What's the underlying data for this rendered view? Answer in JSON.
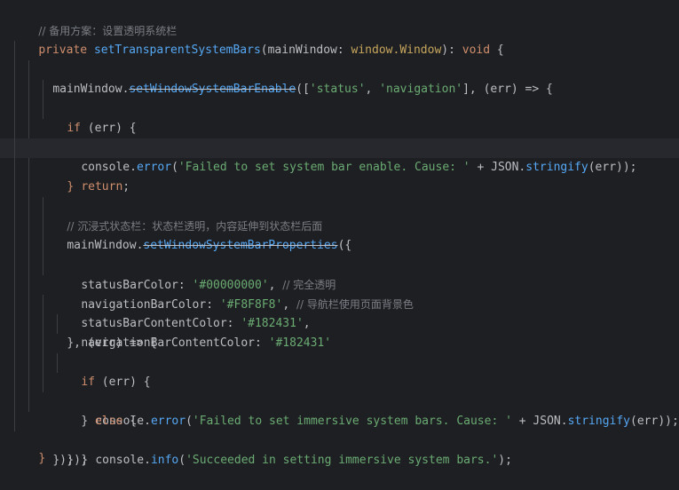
{
  "code": {
    "l1_comment": "// 备用方案：设置透明系统栏",
    "l2_private": "private ",
    "l2_fn": "setTransparentSystemBars",
    "l2_args_open": "(mainWindow: ",
    "l2_type": "window.Window",
    "l2_args_close": "): ",
    "l2_void": "void",
    "l2_brace": " {",
    "l3_obj": "mainWindow.",
    "l3_method": "setWindowSystemBarEnable",
    "l3_open": "([",
    "l3_str1": "'status'",
    "l3_comma": ", ",
    "l3_str2": "'navigation'",
    "l3_rest": "], (err) => {",
    "l4_if": "if",
    "l4_rest": " (err) {",
    "l5_obj": "console.",
    "l5_method": "error",
    "l5_open": "(",
    "l5_str": "'Failed to set system bar enable. Cause: '",
    "l5_plus": " + JSON.",
    "l5_fn": "stringify",
    "l5_rest": "(err));",
    "l6_return": "return",
    "l6_semi": ";",
    "l7_brace": "}",
    "l9_comment": "// 沉浸式状态栏：状态栏透明，内容延伸到状态栏后面",
    "l10_obj": "mainWindow.",
    "l10_method": "setWindowSystemBarProperties",
    "l10_open": "({",
    "l11_key": "statusBarColor: ",
    "l11_val": "'#00000000'",
    "l11_comma": ", ",
    "l11_comment": "// 完全透明",
    "l12_key": "navigationBarColor: ",
    "l12_val": "'#F8F8F8'",
    "l12_comma": ", ",
    "l12_comment": "// 导航栏使用页面背景色",
    "l13_key": "statusBarContentColor: ",
    "l13_val": "'#182431'",
    "l13_comma": ",",
    "l14_key": "navigationBarContentColor: ",
    "l14_val": "'#182431'",
    "l15_text": "}, (err) => {",
    "l16_if": "if",
    "l16_rest": " (err) {",
    "l17_obj": "console.",
    "l17_method": "error",
    "l17_open": "(",
    "l17_str": "'Failed to set immersive system bars. Cause: '",
    "l17_plus": " + JSON.",
    "l17_fn": "stringify",
    "l17_rest": "(err));",
    "l18_close": "} ",
    "l18_else": "else",
    "l18_brace": " {",
    "l19_obj": "console.",
    "l19_method": "info",
    "l19_open": "(",
    "l19_str": "'Succeeded in setting immersive system bars.'",
    "l19_rest": ");",
    "l20_brace": "}",
    "l21_text": "});",
    "l22_text": "});",
    "l23_text": "}"
  },
  "colors": {
    "background": "#1e1f22",
    "keyword": "#cf8e6d",
    "function": "#56a8f5",
    "string": "#6aab73",
    "comment": "#7a7e85",
    "property": "#c77dbb",
    "text": "#bcbec4"
  }
}
